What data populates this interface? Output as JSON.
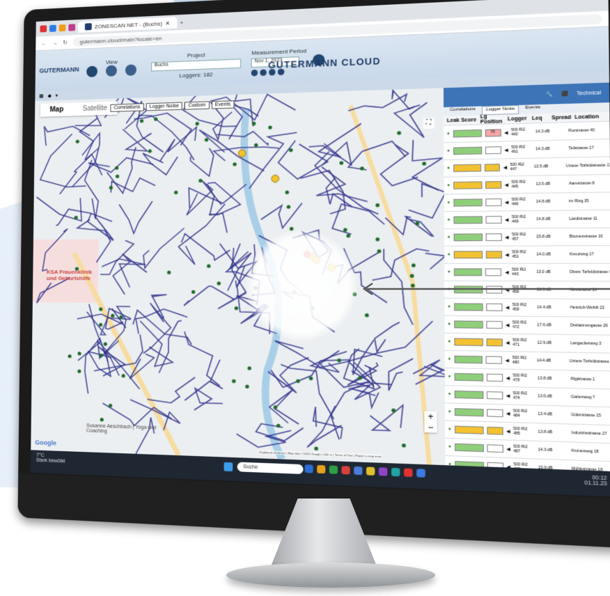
{
  "browser": {
    "tab_title": "ZONESCAN NET - (Buchs)",
    "url": "gutermann.cloud/main?locale=en",
    "new_tab": "+"
  },
  "app": {
    "logo": "GUTERMANN",
    "view_label": "View",
    "project_label": "Project",
    "project_value": "Buchs",
    "loggers_label": "Loggers: 182",
    "measurement_label": "Measurement Period",
    "date_value": "Nov 1, 2023",
    "brand": "GUTERMANN CLOUD",
    "technical_label": "Technical"
  },
  "map": {
    "tabs": [
      "Map",
      "Satellite"
    ],
    "buttons": [
      "Correlations",
      "Logger Noise",
      "Custom",
      "Events"
    ],
    "labels": {
      "hospital": "KSA Frauenklinik und Geburtshilfe",
      "yoga": "Susanne Aeschbach | Yoga und Coaching",
      "google": "Google",
      "footer": "Keyboard shortcuts | Map data ©2023 Google | 100 m | Terms of Use | Report a map error"
    }
  },
  "side": {
    "tabs": [
      "Correlations",
      "Logger Noise",
      "Events"
    ],
    "headers": [
      "Leak Score",
      "Lg Position",
      "Logger",
      "Leq",
      "Spread",
      "Location"
    ],
    "rows": [
      {
        "color": "#8fcf7a",
        "pct": "70",
        "id": "500 Ri2 440",
        "val": "14.3 dB",
        "loc": "Flurstrasse 40"
      },
      {
        "color": "#8fcf7a",
        "pct": "",
        "id": "500 Ri2 491",
        "val": "14.3 dB",
        "loc": "Tellstrasse 17"
      },
      {
        "color": "#f2c230",
        "pct": "",
        "id": "500 Ri2 447",
        "val": "13.5 dB",
        "loc": "Untere Torfeldstrasse 17"
      },
      {
        "color": "#f2c230",
        "pct": "",
        "id": "500 Ri2 445",
        "val": "13.5 dB",
        "loc": "Aarestrasse 8"
      },
      {
        "color": "#8fcf7a",
        "pct": "",
        "id": "500 Ri2 446",
        "val": "14.8 dB",
        "loc": "im Ring 35"
      },
      {
        "color": "#8fcf7a",
        "pct": "",
        "id": "500 Ri2 449",
        "val": "14.8 dB",
        "loc": "Landstrasse 11"
      },
      {
        "color": "#8fcf7a",
        "pct": "",
        "id": "500 Ri2 457",
        "val": "15.8 dB",
        "loc": "Blumenstrasse 10"
      },
      {
        "color": "#f2c230",
        "pct": "",
        "id": "500 Ri2 451",
        "val": "14.0 dB",
        "loc": "Kreuzweg 17"
      },
      {
        "color": "#8fcf7a",
        "pct": "",
        "id": "500 Ri2 443",
        "val": "13.0 dB",
        "loc": "Obere Torfeldstrasse 6"
      },
      {
        "color": "#8fcf7a",
        "pct": "",
        "id": "500 Ri2 456",
        "val": "13.6 dB",
        "loc": "Neustrasse 14"
      },
      {
        "color": "#8fcf7a",
        "pct": "",
        "id": "500 Ri2 459",
        "val": "14.4 dB",
        "loc": "Heinrich-Wehrli 22"
      },
      {
        "color": "#8fcf7a",
        "pct": "",
        "id": "500 Ri2 472",
        "val": "17.6 dB",
        "loc": "Dreitannengasse 26"
      },
      {
        "color": "#f2c230",
        "pct": "",
        "id": "500 Ri2 471",
        "val": "12.9 dB",
        "loc": "Langackerweg 3"
      },
      {
        "color": "#8fcf7a",
        "pct": "",
        "id": "500 Ri2 480",
        "val": "14.4 dB",
        "loc": "Untere Torfeldstrasse 4"
      },
      {
        "color": "#8fcf7a",
        "pct": "",
        "id": "500 Ri2 479",
        "val": "13.8 dB",
        "loc": "Rigistrasse 1"
      },
      {
        "color": "#8fcf7a",
        "pct": "",
        "id": "500 Ri2 474",
        "val": "13.6 dB",
        "loc": "Gartenweg 7"
      },
      {
        "color": "#8fcf7a",
        "pct": "",
        "id": "500 Ri2 484",
        "val": "13.4 dB",
        "loc": "Güterstrasse 15"
      },
      {
        "color": "#f2c230",
        "pct": "",
        "id": "500 Ri2 485",
        "val": "13.8 dB",
        "loc": "Industriestrasse 27"
      },
      {
        "color": "#8fcf7a",
        "pct": "",
        "id": "500 Ri2 487",
        "val": "14.3 dB",
        "loc": "Kronenweg 18"
      },
      {
        "color": "#8fcf7a",
        "pct": "",
        "id": "500 Ri2 489",
        "val": "15.9 dB",
        "loc": "Mühlestrasse 18"
      },
      {
        "color": "#8fcf7a",
        "pct": "",
        "id": "500 Ri2 488",
        "val": "13.0 dB",
        "loc": "Seestrasse 29"
      }
    ]
  },
  "taskbar": {
    "temp": "7°C",
    "weather": "Stark bewölkt",
    "search": "Suche",
    "time": "00:12",
    "date": "01.11.23"
  },
  "colors": {
    "accent": "#3d74b8",
    "pipe": "#2d2f8a",
    "good": "#8fcf7a",
    "warn": "#f2c230"
  }
}
